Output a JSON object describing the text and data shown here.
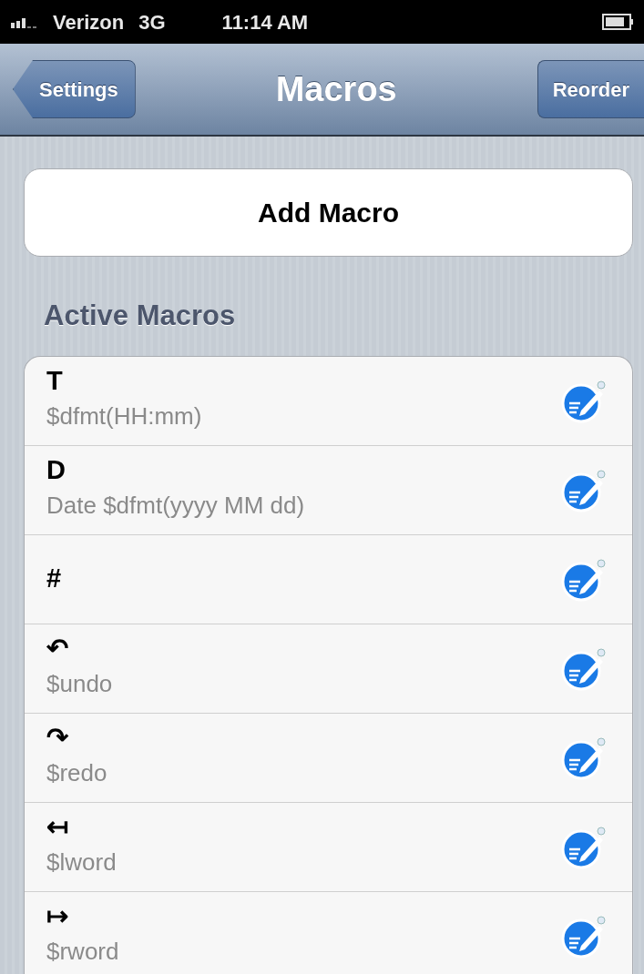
{
  "status_bar": {
    "carrier": "Verizon",
    "network": "3G",
    "time": "11:14 AM"
  },
  "nav_bar": {
    "back_button": "Settings",
    "title": "Macros",
    "right_button": "Reorder"
  },
  "add_button": "Add Macro",
  "section_header": "Active Macros",
  "macros": [
    {
      "name": "T",
      "value": "$dfmt(HH:mm)"
    },
    {
      "name": "D",
      "value": "Date $dfmt(yyyy MM dd)"
    },
    {
      "name": "#"
    },
    {
      "name": "↶",
      "value": "$undo"
    },
    {
      "name": "↷",
      "value": "$redo"
    },
    {
      "name": "↤",
      "value": "$lword"
    },
    {
      "name": "↦",
      "value": "$rword"
    }
  ]
}
